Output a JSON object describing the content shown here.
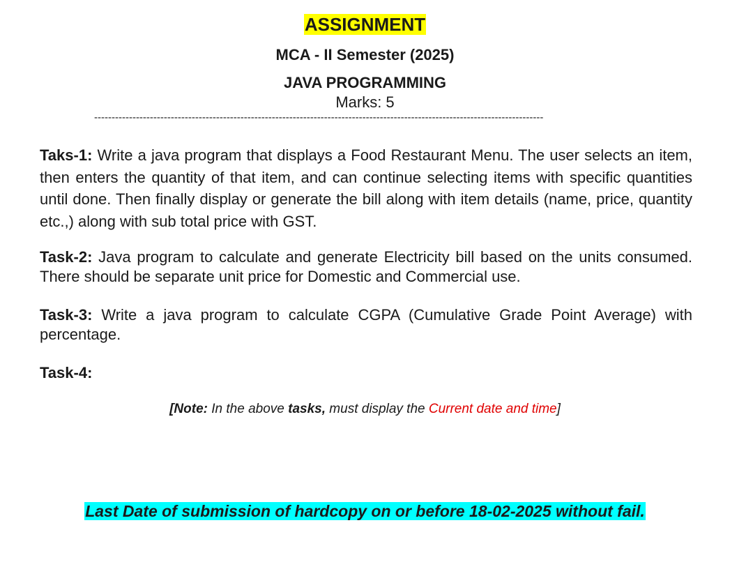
{
  "header": {
    "title": "ASSIGNMENT",
    "subtitle": "MCA - II Semester (2025)",
    "course": "JAVA PROGRAMMING",
    "marks": "Marks: 5",
    "divider": "---------------------------------------------------------------------------------------------------------------------------------"
  },
  "tasks": [
    {
      "label": "Taks-1:",
      "text": " Write a java program that displays a Food Restaurant Menu. The user selects an item, then enters the quantity of that item, and can continue selecting items with specific quantities until done. Then finally display or generate the bill along with item details (name, price, quantity etc.,) along with sub total price with GST."
    },
    {
      "label": "Task-2:",
      "text": " Java program to calculate and generate Electricity bill based on the units consumed. There should be separate unit price for Domestic and Commercial use."
    },
    {
      "label": "Task-3:",
      "text": " Write a java program to calculate CGPA (Cumulative Grade Point Average) with percentage."
    },
    {
      "label": "Task-4:",
      "text": ""
    }
  ],
  "note": {
    "open": "[",
    "label": "Note:",
    "text1": " In the above ",
    "bold": "tasks,",
    "text2": " must display the ",
    "highlight": "Current date and time",
    "close": "]",
    "highlight_color": "#e00000"
  },
  "deadline": {
    "text": "Last Date of submission of hardcopy on or before 18-02-2025 without fail.",
    "highlight_color": "#00ffff"
  },
  "colors": {
    "title_highlight": "#ffff00"
  }
}
